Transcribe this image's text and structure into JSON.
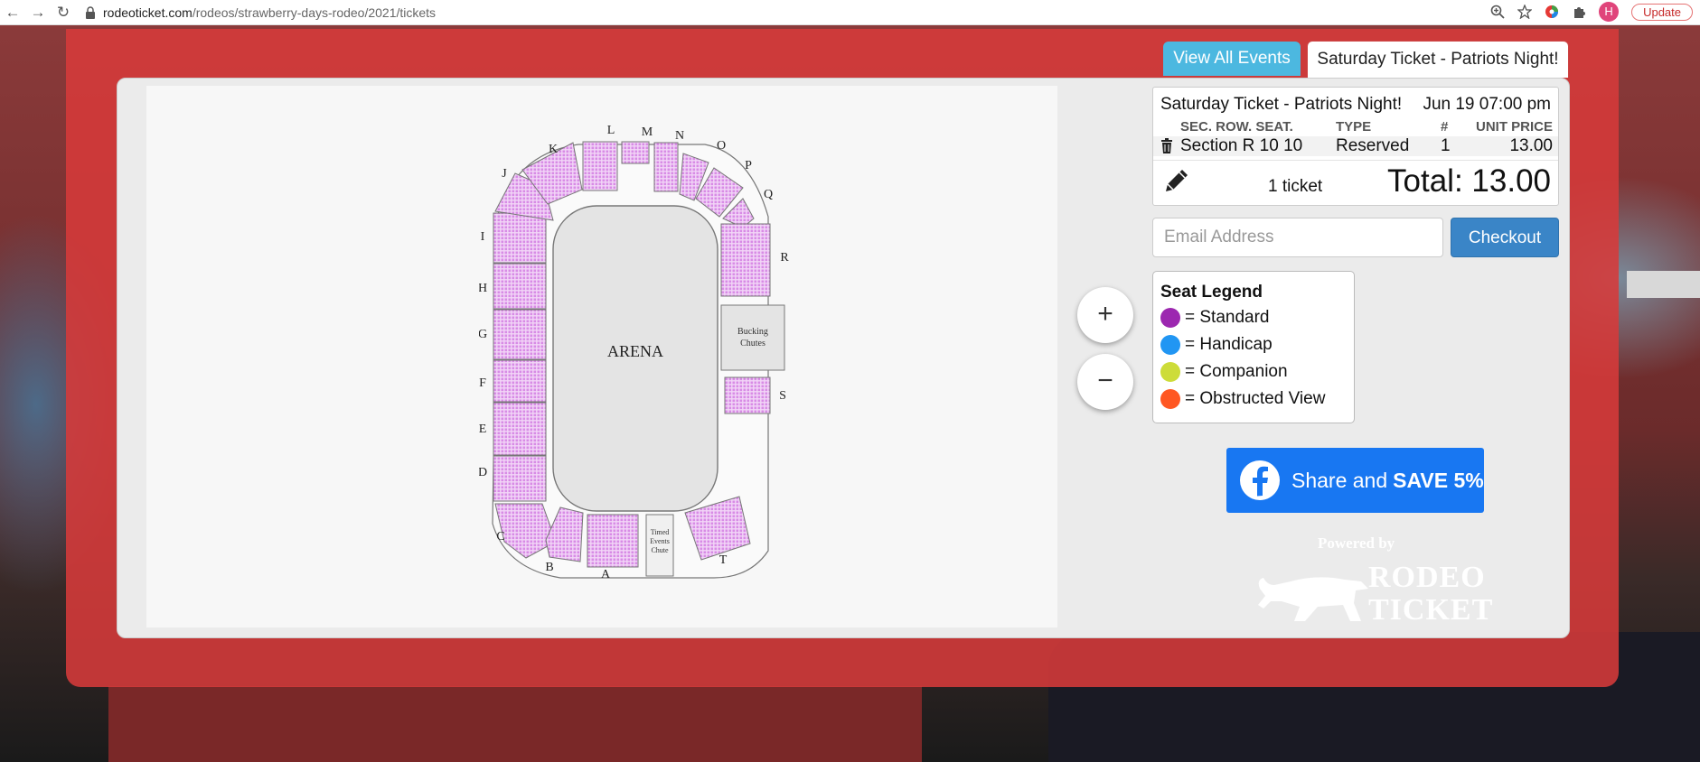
{
  "browser": {
    "back_glyph": "←",
    "forward_glyph": "→",
    "reload_glyph": "↻",
    "url_host": "rodeoticket.com",
    "url_path": "/rodeos/strawberry-days-rodeo/2021/tickets",
    "update_label": "Update",
    "profile_initial": "H"
  },
  "tabs": {
    "view_all": "View All Events",
    "active": "Saturday Ticket - Patriots Night!"
  },
  "arena": {
    "label": "ARENA",
    "bucking_chutes": [
      "Bucking",
      "Chutes"
    ],
    "timed_events": [
      "Timed",
      "Events",
      "Chute"
    ],
    "sections": [
      "A",
      "B",
      "C",
      "D",
      "E",
      "F",
      "G",
      "H",
      "I",
      "J",
      "K",
      "L",
      "M",
      "N",
      "O",
      "P",
      "Q",
      "R",
      "S",
      "T"
    ]
  },
  "zoom": {
    "in": "+",
    "out": "−"
  },
  "order": {
    "event_name": "Saturday Ticket - Patriots Night!",
    "date": "Jun 19 07:00 pm",
    "columns": {
      "sec_row_seat": "SEC. ROW. SEAT.",
      "type": "TYPE",
      "count": "#",
      "unit_price": "UNIT PRICE"
    },
    "line": {
      "seat": "Section R 10 10",
      "type": "Reserved",
      "qty": "1",
      "price": "13.00"
    },
    "ticket_count": "1 ticket",
    "total": "Total: 13.00"
  },
  "checkout": {
    "email_placeholder": "Email Address",
    "button": "Checkout"
  },
  "legend": {
    "title": "Seat Legend",
    "items": [
      {
        "label": "= Standard",
        "color": "#9c27b0"
      },
      {
        "label": "= Handicap",
        "color": "#2196f3"
      },
      {
        "label": "= Companion",
        "color": "#cddc39"
      },
      {
        "label": "= Obstructed View",
        "color": "#ff5722"
      }
    ]
  },
  "share": {
    "prefix": "Share and",
    "bold": "SAVE 5%"
  },
  "powered": {
    "label": "Powered by",
    "brand_line1": "RODEO",
    "brand_line2": "TICKET"
  },
  "colors": {
    "overlay": "#d63a3a",
    "tab_blue": "#4cb8e0",
    "checkout": "#3a85c7",
    "facebook": "#1877f2",
    "seat": "#d88be6"
  }
}
